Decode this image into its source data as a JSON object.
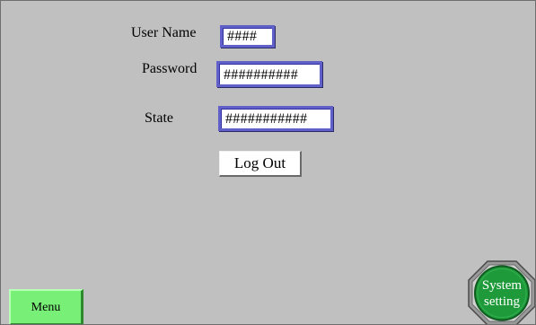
{
  "login_panel": {
    "user_name": {
      "label": "User Name",
      "value": "####"
    },
    "password": {
      "label": "Password",
      "value": "##########"
    },
    "state": {
      "label": "State",
      "value": "###########"
    },
    "logout_label": "Log Out"
  },
  "footer": {
    "menu_label": "Menu",
    "system_setting_line1": "System",
    "system_setting_line2": "setting"
  },
  "colors": {
    "background": "#c0c0c0",
    "field_border": "#6060c8",
    "menu_button": "#78f078",
    "system_button": "#1f9a3a"
  },
  "icons": {
    "system_setting": "octagon-button-icon"
  }
}
